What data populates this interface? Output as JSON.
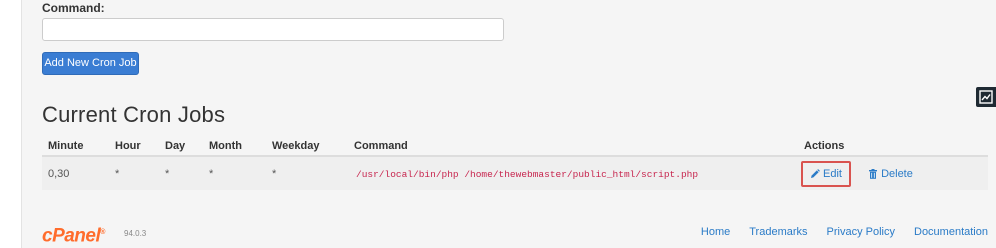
{
  "command_field": {
    "label": "Command:",
    "value": ""
  },
  "add_button": {
    "label": "Add New Cron Job"
  },
  "section_title": "Current Cron Jobs",
  "table": {
    "headers": [
      "Minute",
      "Hour",
      "Day",
      "Month",
      "Weekday",
      "Command",
      "Actions"
    ],
    "rows": [
      {
        "minute": "0,30",
        "hour": "*",
        "day": "*",
        "month": "*",
        "weekday": "*",
        "command": "/usr/local/bin/php /home/thewebmaster/public_html/script.php",
        "edit_label": "Edit",
        "delete_label": "Delete"
      }
    ]
  },
  "side_widget": {
    "icon": "chart-trend-icon"
  },
  "footer": {
    "logo": "cPanel",
    "version": "94.0.3",
    "links": [
      "Home",
      "Trademarks",
      "Privacy Policy",
      "Documentation"
    ]
  },
  "colors": {
    "primary_button": "#3a7dd3",
    "link": "#2a7bc7",
    "highlight_box": "#d9534f",
    "code_text": "#c7254e",
    "logo": "#ff6c2c"
  }
}
